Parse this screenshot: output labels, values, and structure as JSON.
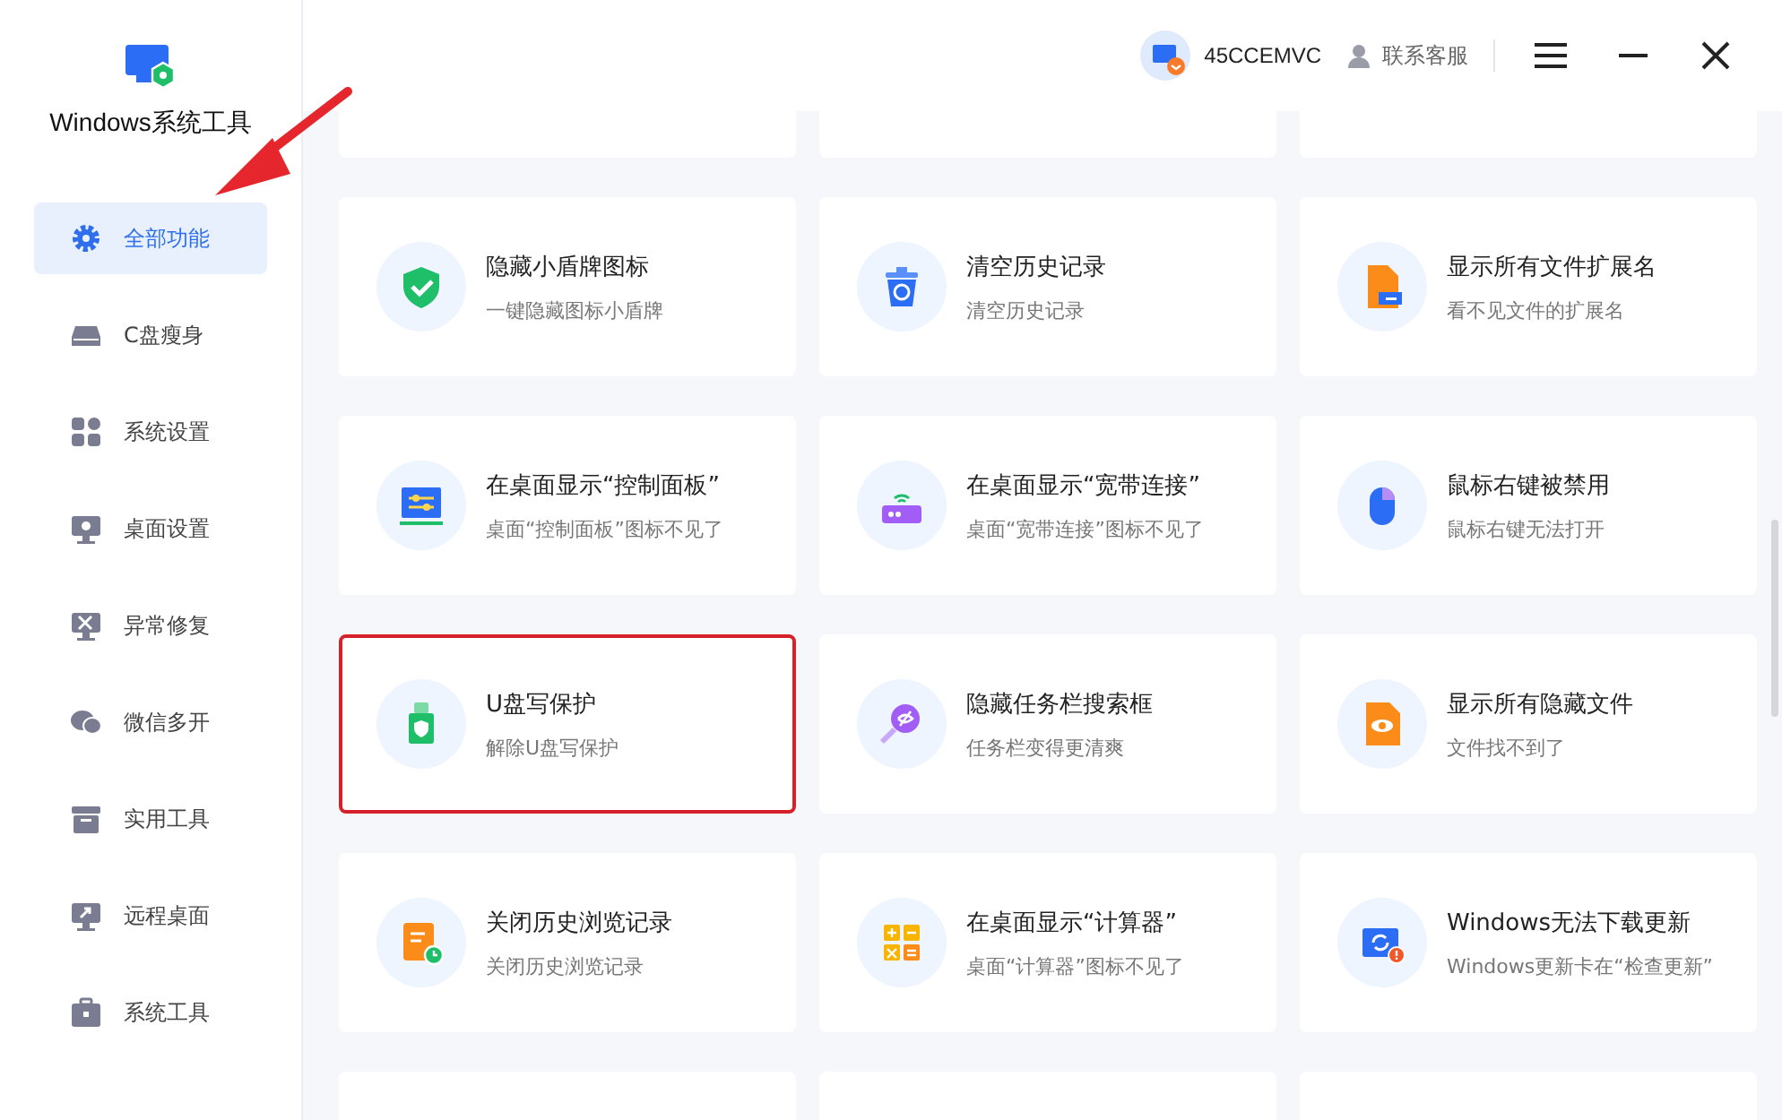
{
  "app": {
    "title": "Windows系统工具"
  },
  "sidebar": {
    "items": [
      {
        "label": "全部功能",
        "kind": "gear",
        "selected": true
      },
      {
        "label": "C盘瘦身",
        "kind": "drive",
        "selected": false
      },
      {
        "label": "系统设置",
        "kind": "apps",
        "selected": false
      },
      {
        "label": "桌面设置",
        "kind": "monitor-gear",
        "selected": false
      },
      {
        "label": "异常修复",
        "kind": "monitor-tools",
        "selected": false
      },
      {
        "label": "微信多开",
        "kind": "chat",
        "selected": false
      },
      {
        "label": "实用工具",
        "kind": "box",
        "selected": false
      },
      {
        "label": "远程桌面",
        "kind": "monitor-arrow",
        "selected": false
      },
      {
        "label": "系统工具",
        "kind": "briefcase",
        "selected": false
      }
    ]
  },
  "header": {
    "account": "45CCEMVC",
    "support": "联系客服"
  },
  "cards": [
    {
      "title": "隐藏小盾牌图标",
      "subtitle": "一键隐藏图标小盾牌",
      "kind": "shield",
      "highlighted": false
    },
    {
      "title": "清空历史记录",
      "subtitle": "清空历史记录",
      "kind": "trash",
      "highlighted": false
    },
    {
      "title": "显示所有文件扩展名",
      "subtitle": "看不见文件的扩展名",
      "kind": "file-ext",
      "highlighted": false
    },
    {
      "title": "在桌面显示“控制面板”",
      "subtitle": "桌面“控制面板”图标不见了",
      "kind": "panel",
      "highlighted": false
    },
    {
      "title": "在桌面显示“宽带连接”",
      "subtitle": "桌面“宽带连接”图标不见了",
      "kind": "router",
      "highlighted": false
    },
    {
      "title": "鼠标右键被禁用",
      "subtitle": "鼠标右键无法打开",
      "kind": "mouse",
      "highlighted": false
    },
    {
      "title": "U盘写保护",
      "subtitle": "解除U盘写保护",
      "kind": "usb",
      "highlighted": true
    },
    {
      "title": "隐藏任务栏搜索框",
      "subtitle": "任务栏变得更清爽",
      "kind": "search-hide",
      "highlighted": false
    },
    {
      "title": "显示所有隐藏文件",
      "subtitle": "文件找不到了",
      "kind": "file-eye",
      "highlighted": false
    },
    {
      "title": "关闭历史浏览记录",
      "subtitle": "关闭历史浏览记录",
      "kind": "doc-clock",
      "highlighted": false
    },
    {
      "title": "在桌面显示“计算器”",
      "subtitle": "桌面“计算器”图标不见了",
      "kind": "calc",
      "highlighted": false
    },
    {
      "title": "Windows无法下载更新",
      "subtitle": "Windows更新卡在“检查更新”",
      "kind": "update",
      "highlighted": false
    }
  ]
}
